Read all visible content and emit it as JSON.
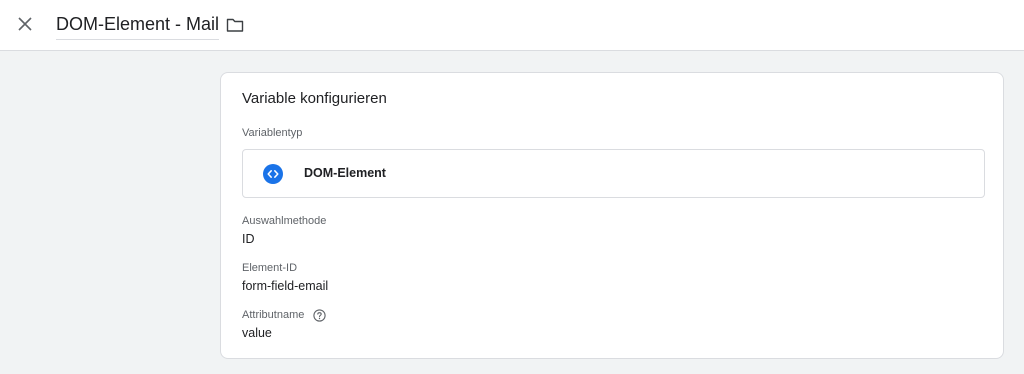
{
  "header": {
    "title": "DOM-Element - Mail",
    "close_icon": "close-icon",
    "folder_icon": "folder-icon"
  },
  "card": {
    "title": "Variable konfigurieren",
    "variable_type": {
      "label": "Variablentyp",
      "value": "DOM-Element",
      "icon": "code-brackets-icon"
    },
    "selection_method": {
      "label": "Auswahlmethode",
      "value": "ID"
    },
    "element_id": {
      "label": "Element-ID",
      "value": "form-field-email"
    },
    "attribute_name": {
      "label": "Attributname",
      "value": "value",
      "help_icon": "help-circle-icon"
    }
  },
  "colors": {
    "accent": "#1a73e8",
    "background": "#f1f3f4",
    "card": "#ffffff",
    "border": "#dadce0",
    "text": "#202124",
    "secondary_text": "#5f6368"
  }
}
